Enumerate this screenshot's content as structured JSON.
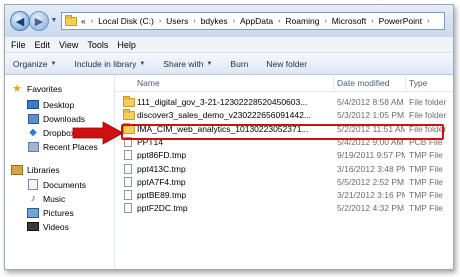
{
  "address": {
    "chevrons": "«",
    "crumbs": [
      "Local Disk (C:)",
      "Users",
      "bdykes",
      "AppData",
      "Roaming",
      "Microsoft",
      "PowerPoint"
    ],
    "separator": "›"
  },
  "menu": [
    "File",
    "Edit",
    "View",
    "Tools",
    "Help"
  ],
  "toolbar": {
    "organize": "Organize",
    "include": "Include in library",
    "share": "Share with",
    "burn": "Burn",
    "new_folder": "New folder"
  },
  "nav": {
    "favorites": "Favorites",
    "desktop": "Desktop",
    "downloads": "Downloads",
    "dropbox": "Dropbox",
    "recent": "Recent Places",
    "libraries": "Libraries",
    "documents": "Documents",
    "music": "Music",
    "pictures": "Pictures",
    "videos": "Videos"
  },
  "columns": {
    "name": "Name",
    "date": "Date modified",
    "type": "Type"
  },
  "files": [
    {
      "name": "111_digital_gov_3-21-12302228520450603...",
      "date": "5/4/2012 8:58 AM",
      "type": "File folder",
      "kind": "folder"
    },
    {
      "name": "discover3_sales_demo_v230222656091442...",
      "date": "5/3/2012 1:05 PM",
      "type": "File folder",
      "kind": "folder"
    },
    {
      "name": "IMA_CIM_web_analytics_10130223052371...",
      "date": "5/2/2012 11:51 AM",
      "type": "File folder",
      "kind": "folder"
    },
    {
      "name": "PPT14",
      "date": "5/4/2012 9:00 AM",
      "type": "PCB File",
      "kind": "file"
    },
    {
      "name": "ppt86FD.tmp",
      "date": "9/19/2011 9:57 PM",
      "type": "TMP File",
      "kind": "file"
    },
    {
      "name": "ppt413C.tmp",
      "date": "3/16/2012 3:48 PM",
      "type": "TMP File",
      "kind": "file"
    },
    {
      "name": "pptA7F4.tmp",
      "date": "5/5/2012 2:52 PM",
      "type": "TMP File",
      "kind": "file"
    },
    {
      "name": "pptBE89.tmp",
      "date": "3/21/2012 3:16 PM",
      "type": "TMP File",
      "kind": "file"
    },
    {
      "name": "pptF2DC.tmp",
      "date": "5/2/2012 4:32 PM",
      "type": "TMP File",
      "kind": "file"
    }
  ],
  "colors": {
    "highlight": "#d01010",
    "arrow": "#d01010",
    "toolbar_text": "#1d2f4a"
  }
}
